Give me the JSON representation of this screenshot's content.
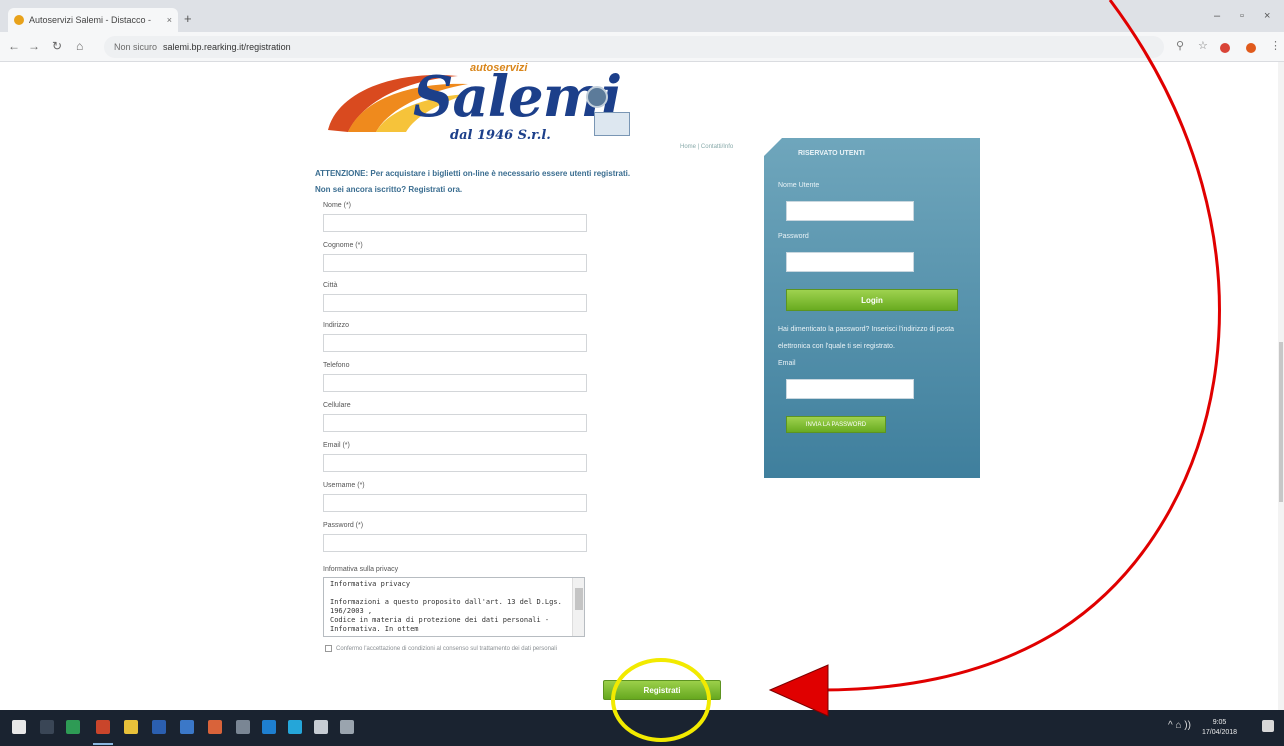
{
  "browser": {
    "tab_title": "Autoservizi Salemi - Distacco  - ",
    "tab_close": "×",
    "new_tab": "+",
    "win_min": "–",
    "win_max": "▫",
    "win_close": "×",
    "nav_back": "←",
    "nav_forward": "→",
    "nav_reload": "↻",
    "nav_home": "⌂",
    "security": "Non sicuro",
    "url": "salemi.bp.rearking.it/registration"
  },
  "page": {
    "logo_word": "Salemi",
    "logo_autoservizi": "autoservizi",
    "logo_since": "dal 1946  S.r.l.",
    "small_link": "Home | Contatti/Info",
    "notice_line1": "ATTENZIONE: Per acquistare i biglietti on-line è necessario essere utenti registrati.",
    "notice_line2": "Non sei ancora iscritto? Registrati ora.",
    "fields": [
      {
        "label": "Nome (*)"
      },
      {
        "label": "Cognome (*)"
      },
      {
        "label": "Città"
      },
      {
        "label": "Indirizzo"
      },
      {
        "label": "Telefono"
      },
      {
        "label": "Cellulare"
      },
      {
        "label": "Email (*)"
      },
      {
        "label": "Username (*)"
      },
      {
        "label": "Password (*)"
      }
    ],
    "privacy_label": "Informativa sulla privacy",
    "privacy_text_1": "Informativa privacy",
    "privacy_text_2": "Informazioni a questo proposito dall'art. 13 del D.Lgs. 196/2003 ,",
    "privacy_text_3": "Codice in materia di protezione dei dati personali - Informativa. In ottem",
    "consent_text": "Confermo l'accettazione di condizioni al consenso sul trattamento dei dati personali",
    "register_button": "Registrati"
  },
  "login": {
    "title": "RISERVATO UTENTI",
    "username_label": "Nome Utente",
    "password_label": "Password",
    "login_button": "Login",
    "forgot_note": "Hai dimenticato la password? Inserisci l'indirizzo di posta elettronica con l'quale ti sei registrato.",
    "email_label": "Email",
    "recover_button": "INVIA LA PASSWORD"
  },
  "taskbar": {
    "time": "9:05",
    "date": "17/04/2018",
    "tray": "^ ⌂ ))"
  },
  "colors": {
    "accent_green": "#7cbd32",
    "sidebar_blue": "#4e8aa8",
    "annotation_red": "#e00000",
    "annotation_yellow": "#f2ea00"
  }
}
